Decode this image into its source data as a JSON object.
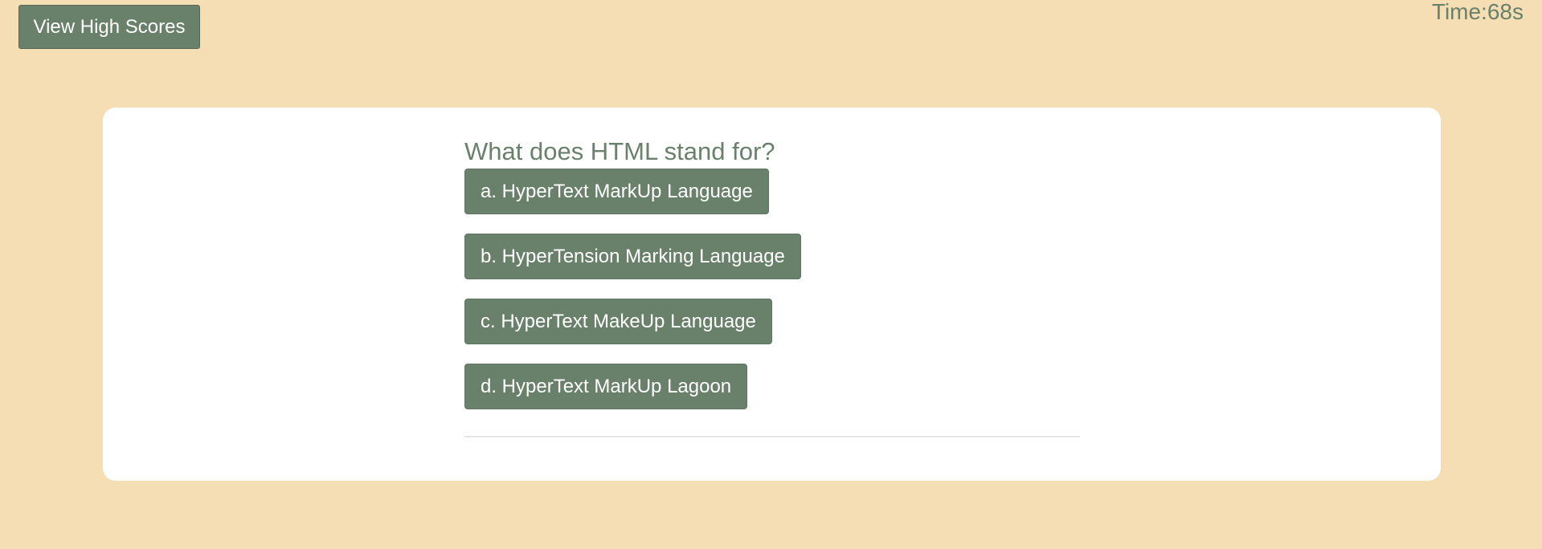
{
  "header": {
    "high_scores_label": "View High Scores",
    "timer_label": "Time:",
    "timer_value": "68s"
  },
  "quiz": {
    "question": "What does HTML stand for?",
    "answers": [
      {
        "label": "a. HyperText MarkUp Language"
      },
      {
        "label": "b. HyperTension Marking Language"
      },
      {
        "label": "c. HyperText MakeUp Language"
      },
      {
        "label": "d. HyperText MarkUp Lagoon"
      }
    ]
  },
  "colors": {
    "background": "#f5deb3",
    "accent": "#69806b",
    "card": "#ffffff"
  }
}
